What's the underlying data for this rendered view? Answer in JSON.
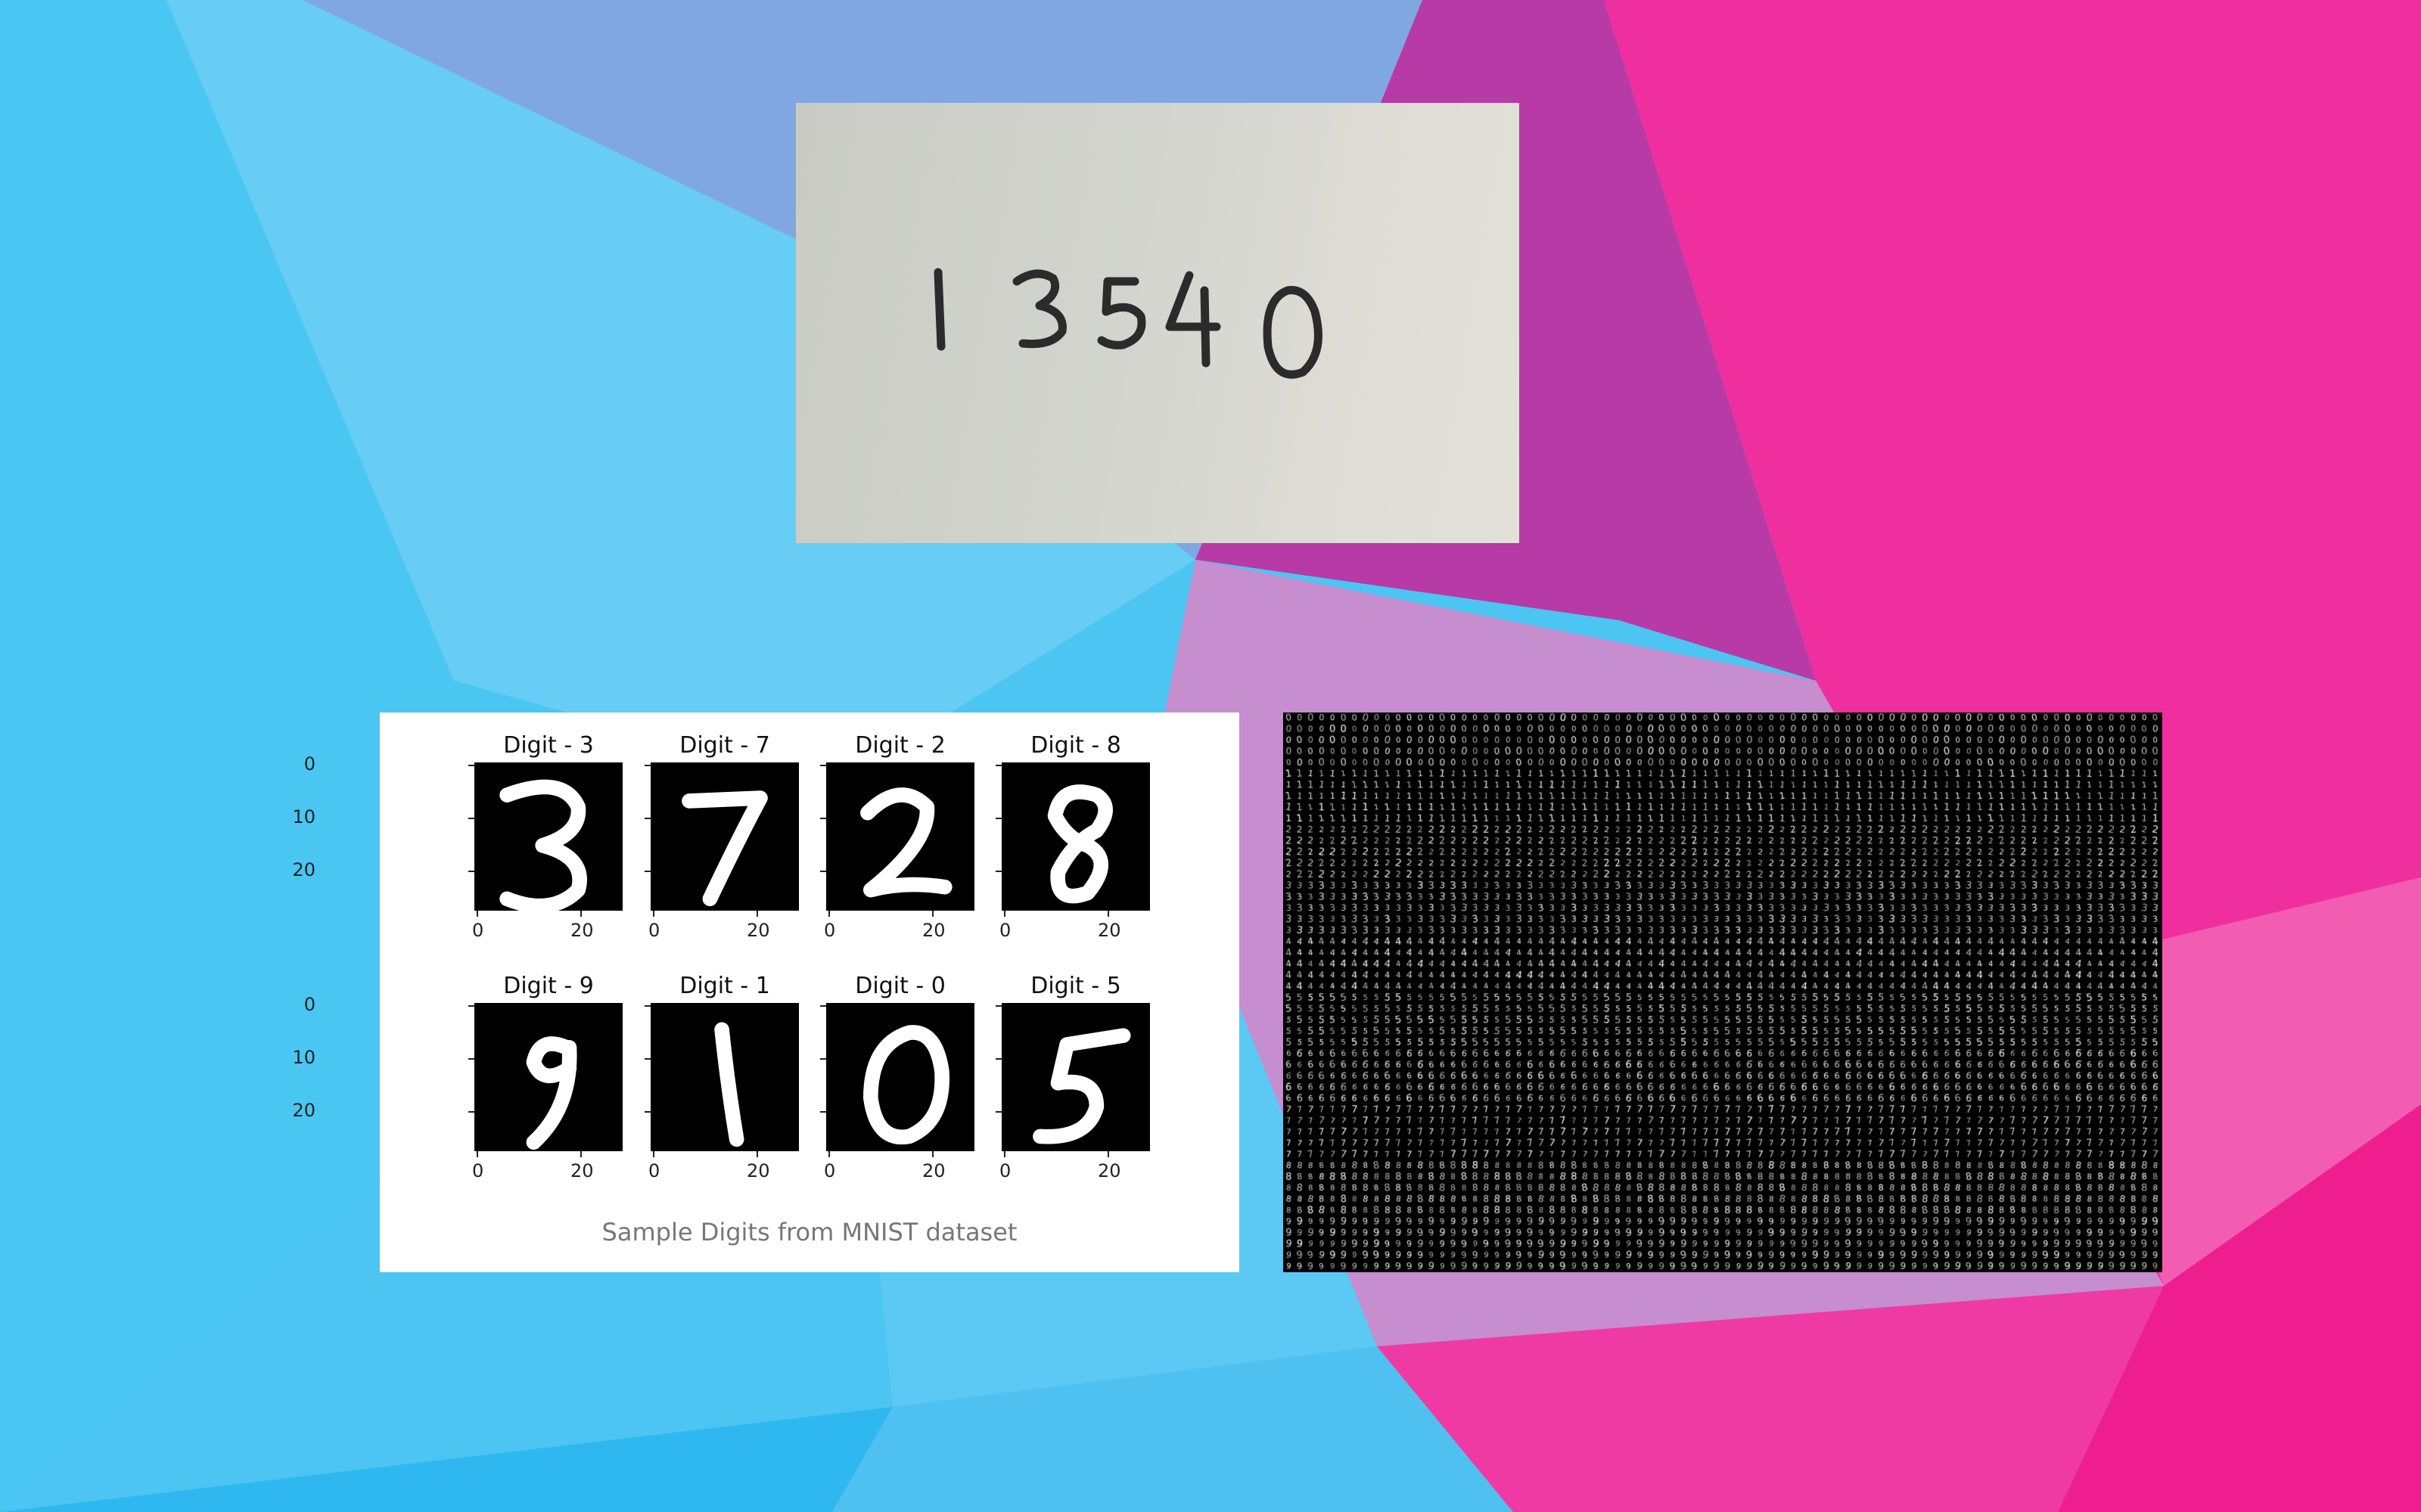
{
  "handwritten_photo": {
    "text": "13540"
  },
  "mnist_samples": {
    "caption": "Sample Digits from MNIST dataset",
    "cells": [
      {
        "title": "Digit - 3",
        "digit": "3"
      },
      {
        "title": "Digit - 7",
        "digit": "7"
      },
      {
        "title": "Digit - 2",
        "digit": "2"
      },
      {
        "title": "Digit - 8",
        "digit": "8"
      },
      {
        "title": "Digit - 9",
        "digit": "9"
      },
      {
        "title": "Digit - 1",
        "digit": "1"
      },
      {
        "title": "Digit - 0",
        "digit": "0"
      },
      {
        "title": "Digit - 5",
        "digit": "5"
      }
    ],
    "y_ticks": [
      "0",
      "10",
      "20"
    ],
    "x_ticks": [
      "0",
      "20"
    ]
  },
  "mnist_grid": {
    "rows": [
      "0",
      "1",
      "2",
      "3",
      "4",
      "5",
      "6",
      "7",
      "8",
      "9"
    ]
  },
  "colors": {
    "blue": "#4cc5f2",
    "pink": "#f02f9e",
    "purple": "#b83aa6",
    "lavender": "#c68dcf"
  }
}
